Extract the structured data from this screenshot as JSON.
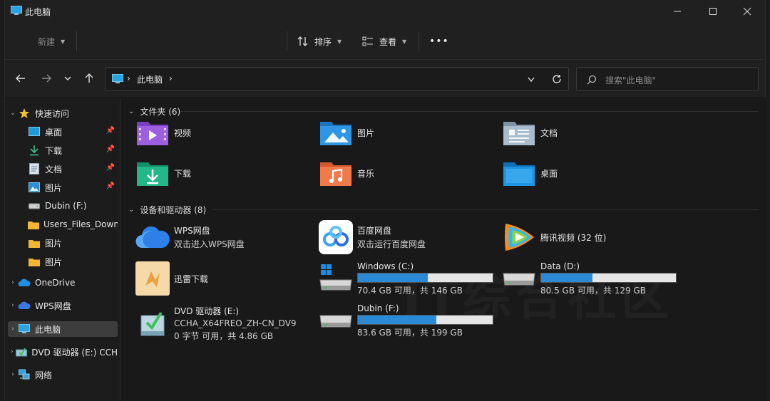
{
  "window": {
    "title": "此电脑",
    "controls": [
      "minimize",
      "maximize",
      "close"
    ]
  },
  "commandbar": {
    "new_label": "新建",
    "sort_label": "排序",
    "view_label": "查看",
    "more_label": "•••"
  },
  "address": {
    "crumbs": [
      "此电脑"
    ],
    "search_placeholder": "搜索\"此电脑\""
  },
  "sidebar": {
    "items": [
      {
        "label": "快速访问",
        "icon": "star-icon"
      },
      {
        "label": "桌面",
        "icon": "desktop-icon",
        "pinned": true
      },
      {
        "label": "下载",
        "icon": "download-icon",
        "pinned": true
      },
      {
        "label": "文档",
        "icon": "document-icon",
        "pinned": true
      },
      {
        "label": "图片",
        "icon": "picture-icon",
        "pinned": true
      },
      {
        "label": "Dubin (F:)",
        "icon": "drive-icon"
      },
      {
        "label": "Users_Files_Down",
        "icon": "folder-icon"
      },
      {
        "label": "图片",
        "icon": "folder-icon"
      },
      {
        "label": "图片",
        "icon": "folder-icon"
      },
      {
        "label": "OneDrive",
        "icon": "cloud-icon"
      },
      {
        "label": "WPS网盘",
        "icon": "wps-cloud-icon"
      },
      {
        "label": "此电脑",
        "icon": "computer-icon",
        "selected": true
      },
      {
        "label": "DVD 驱动器 (E:) CCH",
        "icon": "dvd-icon"
      },
      {
        "label": "网络",
        "icon": "network-icon"
      }
    ]
  },
  "content": {
    "folders_header": "文件夹 (6)",
    "folders": [
      {
        "name": "视频",
        "icon": "video-folder-icon"
      },
      {
        "name": "图片",
        "icon": "pictures-folder-icon"
      },
      {
        "name": "文档",
        "icon": "documents-folder-icon"
      },
      {
        "name": "下载",
        "icon": "downloads-folder-icon"
      },
      {
        "name": "音乐",
        "icon": "music-folder-icon"
      },
      {
        "name": "桌面",
        "icon": "desktop-folder-icon"
      }
    ],
    "devices_header": "设备和驱动器 (8)",
    "devices": [
      {
        "name": "WPS网盘",
        "sub": "双击进入WPS网盘",
        "icon": "wps-cloud-icon"
      },
      {
        "name": "百度网盘",
        "sub": "双击运行百度网盘",
        "icon": "baidu-netdisk-icon"
      },
      {
        "name": "腾讯视频 (32 位)",
        "sub": "",
        "icon": "tencent-video-icon"
      },
      {
        "name": "迅雷下载",
        "sub": "",
        "icon": "xunlei-icon"
      },
      {
        "name": "Windows (C:)",
        "sub": "70.4 GB 可用，共 146 GB",
        "icon": "windows-drive-icon",
        "used_fraction": 0.52
      },
      {
        "name": "Data (D:)",
        "sub": "80.5 GB 可用，共 129 GB",
        "icon": "drive-icon",
        "used_fraction": 0.38
      },
      {
        "name": "DVD 驱动器 (E:)",
        "sub": "CCHA_X64FREO_ZH-CN_DV9",
        "sub2": "0 字节 可用，共 4.86 GB",
        "icon": "dvd-drive-icon"
      },
      {
        "name": "Dubin (F:)",
        "sub": "83.6 GB 可用，共 199 GB",
        "icon": "drive-icon",
        "used_fraction": 0.58
      }
    ]
  },
  "colors": {
    "bar_fill": "#2a8ad6",
    "bar_bg": "#e6e6e6"
  }
}
